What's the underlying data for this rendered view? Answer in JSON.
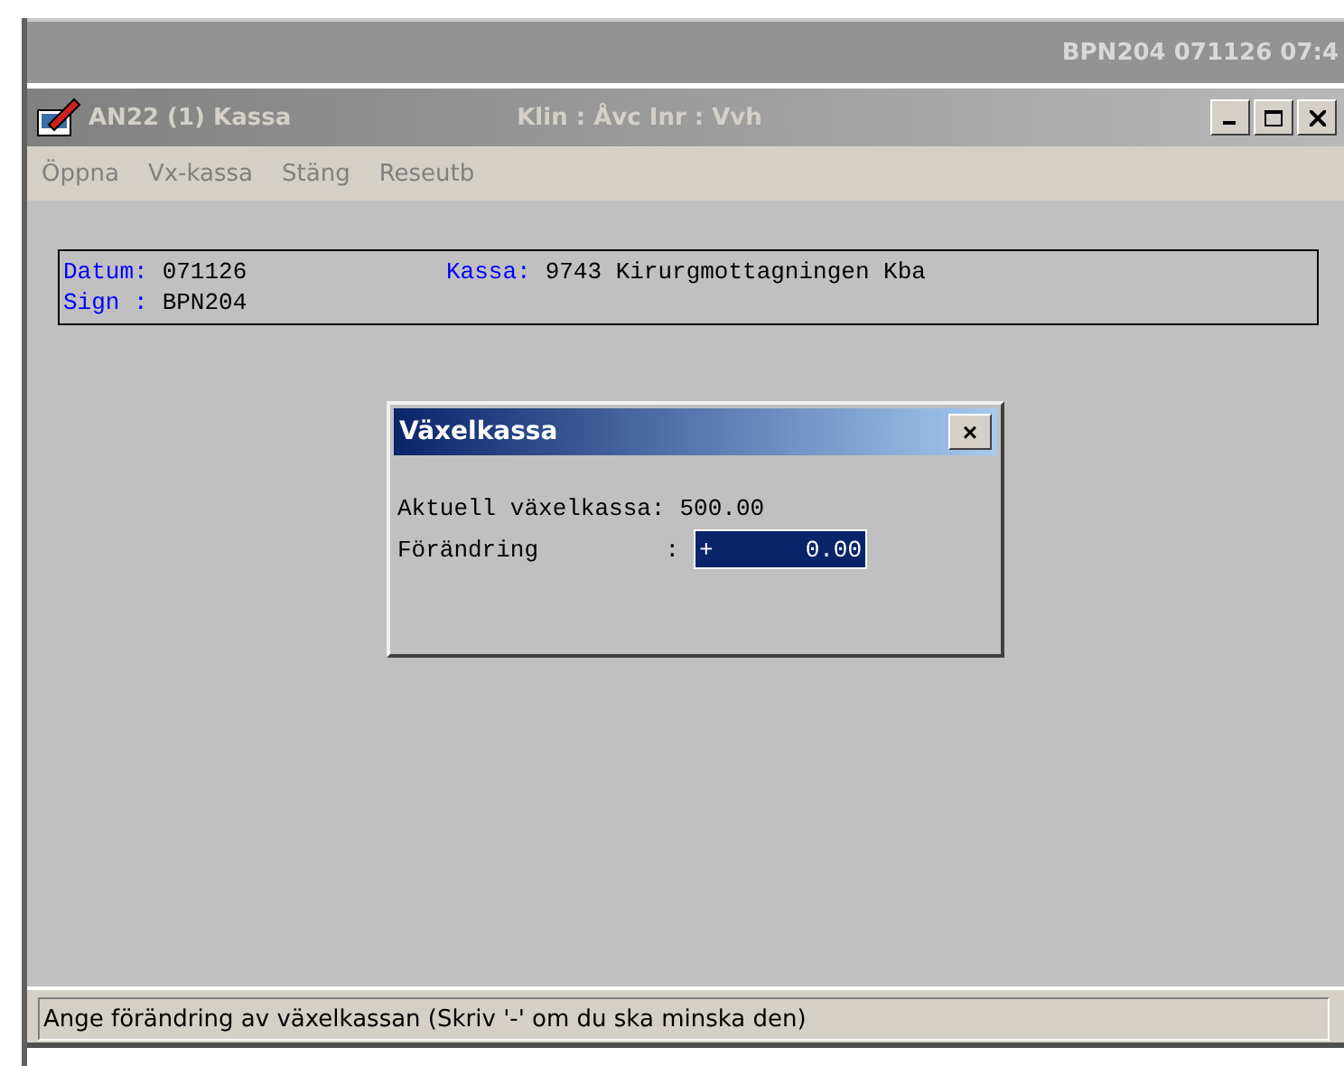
{
  "top_bar": {
    "text": "BPN204 071126 07:4"
  },
  "window": {
    "title": "AN22 (1) Kassa",
    "subtitle": "Klin : Åvc  Inr : Vvh",
    "active": false
  },
  "menu": [
    {
      "label": "Öppna",
      "disabled": true
    },
    {
      "label": "Vx-kassa",
      "disabled": true
    },
    {
      "label": "Stäng",
      "disabled": true
    },
    {
      "label": "Reseutb",
      "disabled": true
    }
  ],
  "info": [
    [
      {
        "label": "Datum:",
        "value": "071126"
      },
      {
        "label": "Kassa:",
        "value": "9743 Kirurgmottagningen Kba"
      }
    ],
    [
      {
        "label": "Sign :",
        "value": "BPN204"
      }
    ]
  ],
  "dialog": {
    "title": "Växelkassa",
    "close": "×",
    "rows": [
      {
        "label": "Aktuell växelkassa:",
        "value": "500.00",
        "kind": "text"
      },
      {
        "label": "Förändring         :",
        "sign": "+",
        "value": "0.00",
        "kind": "input"
      }
    ]
  },
  "status_bar": "Ange förändring av växelkassan (Skriv '-' om du ska minska den)"
}
